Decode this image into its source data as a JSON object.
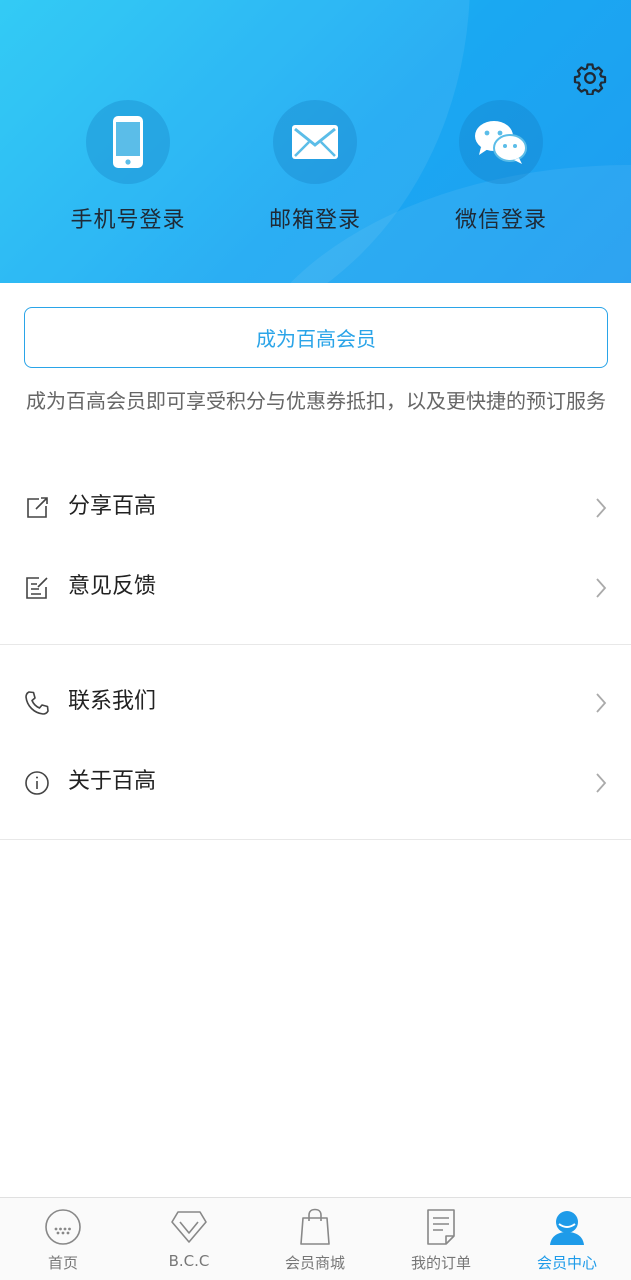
{
  "header": {
    "login_options": [
      {
        "label": "手机号登录",
        "icon": "phone-icon"
      },
      {
        "label": "邮箱登录",
        "icon": "mail-icon"
      },
      {
        "label": "微信登录",
        "icon": "wechat-icon"
      }
    ],
    "settings_icon": "gear-icon"
  },
  "membership": {
    "button_label": "成为百高会员",
    "description": "成为百高会员即可享受积分与优惠券抵扣，以及更快捷的预订服务"
  },
  "menu": [
    {
      "label": "分享百高",
      "icon": "share-icon"
    },
    {
      "label": "意见反馈",
      "icon": "feedback-icon"
    },
    {
      "label": "联系我们",
      "icon": "phone-call-icon"
    },
    {
      "label": "关于百高",
      "icon": "info-icon"
    }
  ],
  "tabbar": {
    "items": [
      {
        "label": "首页",
        "icon": "home-chat-icon"
      },
      {
        "label": "B.C.C",
        "icon": "diamond-icon"
      },
      {
        "label": "会员商城",
        "icon": "shopping-bag-icon"
      },
      {
        "label": "我的订单",
        "icon": "order-icon"
      },
      {
        "label": "会员中心",
        "icon": "user-icon",
        "active": true
      }
    ]
  },
  "colors": {
    "accent": "#1e9be9",
    "header_gradient_start": "#22c7f5",
    "header_gradient_end": "#1f9df0"
  }
}
